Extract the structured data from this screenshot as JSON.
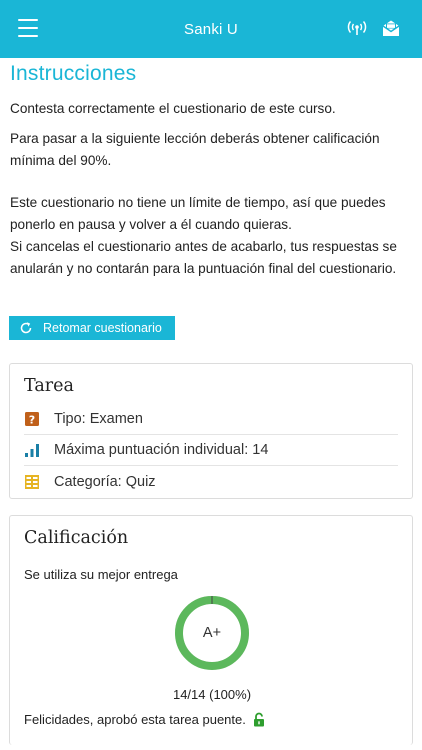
{
  "header": {
    "title": "Sanki U",
    "menu_icon": "hamburger-menu-icon",
    "signal_icon": "broadcast-signal-icon",
    "mail_icon": "open-envelope-icon"
  },
  "instructions": {
    "title": "Instrucciones",
    "p1": "Contesta correctamente el cuestionario de este curso.",
    "p2": "Para pasar a la siguiente lección deberás obtener calificación mínima del 90%.",
    "p3a": "Este cuestionario no tiene un límite de tiempo, así que puedes ponerlo en pausa y volver a él cuando quieras.",
    "p3b": "Si cancelas el cuestionario antes de acabarlo, tus respuestas se anularán y no contarán para la puntuación final del cuestionario.",
    "retake_label": "Retomar cuestionario"
  },
  "tarea": {
    "title": "Tarea",
    "rows": [
      {
        "icon": "question-mark-icon",
        "label": "Tipo: Examen"
      },
      {
        "icon": "bar-chart-icon",
        "label": "Máxima puntuación individual: 14"
      },
      {
        "icon": "category-grid-icon",
        "label": "Categoría: Quiz"
      }
    ]
  },
  "calificacion": {
    "title": "Calificación",
    "subtitle": "Se utiliza su mejor entrega",
    "grade": "A+",
    "progress_fraction": 1.0,
    "score": "14/14 (100%)",
    "message": "Felicidades, aprobó esta tarea puente.",
    "unlock_icon": "unlocked-padlock-icon"
  },
  "colors": {
    "accent": "#1ab6d6",
    "ring": "#5cb85c",
    "question_icon": "#c0601a",
    "bar_icon": "#1a7fa6",
    "grid_icon": "#e6b422",
    "unlock": "#2e9e2e"
  }
}
